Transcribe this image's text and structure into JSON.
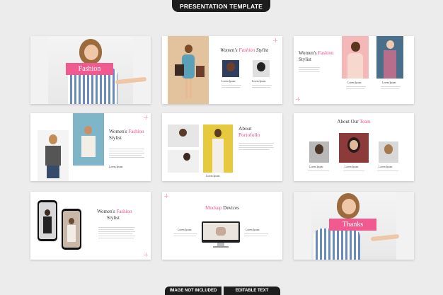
{
  "header": {
    "title": "PRESENTATION TEMPLATE"
  },
  "footer": {
    "left": "IMAGE NOT INCLUDED",
    "right": "EDITABLE TEXT"
  },
  "slides": {
    "s1": {
      "label": "Fashion"
    },
    "s2": {
      "title_a": "Women's ",
      "title_b": "Fashion",
      "title_c": " Stylist",
      "cap1": "Lorem Ipsum",
      "cap2": "Lorem Ipsum"
    },
    "s3": {
      "title_a": "Women's ",
      "title_b": "Fashion",
      "title_c": "Stylist",
      "cap1": "Lorem Ipsum",
      "cap2": "Lorem Ipsum"
    },
    "s4": {
      "title_a": "Women's ",
      "title_b": "Fashion",
      "title_c": "Stylist",
      "cap": "Lorem Ipsum"
    },
    "s5": {
      "title_a": "About",
      "title_b": "Portofolio",
      "cap": "Lorem Ipsum"
    },
    "s6": {
      "title_a": "About Our ",
      "title_b": "Team",
      "cap1": "Lorem Ipsum",
      "cap2": "Lorem Ipsum",
      "cap3": "Lorem Ipsum"
    },
    "s7": {
      "title_a": "Women's ",
      "title_b": "Fashion",
      "title_c": "Stylist"
    },
    "s8": {
      "title_a": "Mockup ",
      "title_b": "Devices",
      "cap1": "Lorem Ipsum",
      "cap2": "Lorem Ipsum"
    },
    "s9": {
      "label": "Thanks"
    }
  },
  "colors": {
    "accent": "#f05a8e",
    "dark": "#1d1d1d",
    "background": "#ececec"
  }
}
